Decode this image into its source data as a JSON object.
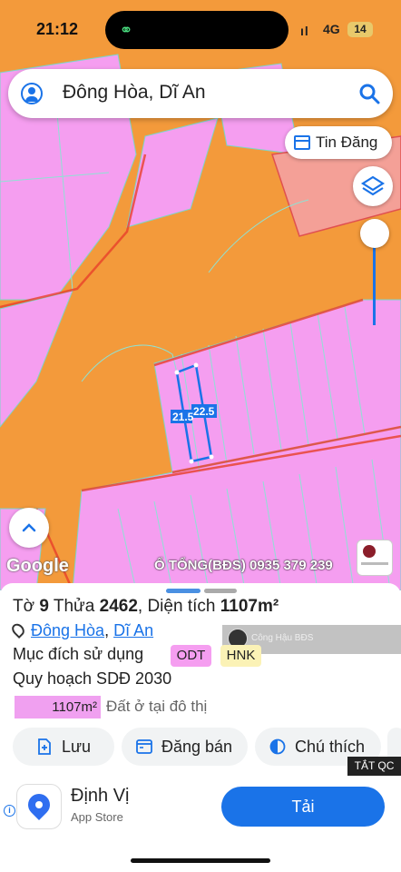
{
  "status_bar": {
    "time": "21:12",
    "network": "4G",
    "battery": "14"
  },
  "search": {
    "query": "Đông Hòa, Dĩ An"
  },
  "map": {
    "tin_dang_label": "Tin Đăng",
    "parcel_dims": [
      "21.5",
      "22.5"
    ],
    "google_logo": "Google",
    "watermark": "Ổ TỔNG(BĐS) 0935 379 239",
    "colors": {
      "road": "#f39a3b",
      "residential": "#f59ef0",
      "commercial": "#f4a097"
    }
  },
  "info": {
    "title_prefix": "Tờ",
    "sheet_no": "9",
    "plot_label": "Thửa",
    "plot_no": "2462",
    "area_label": ", Diện tích",
    "area_value": "1107m²",
    "ward": "Đông Hòa",
    "district": "Dĩ An",
    "purpose_label": "Mục đích sử dụng",
    "purpose_tags": [
      "ODT",
      "HNK"
    ],
    "plan_label": "Quy hoạch SDĐ 2030",
    "plan_area": "1107m²",
    "plan_desc": "Đất ở tại đô thị",
    "ad_overlay_name": "Công Hậu BĐS"
  },
  "actions": {
    "save": "Lưu",
    "post": "Đăng bán",
    "legend": "Chú thích"
  },
  "ad": {
    "hide_label": "TẮT QC",
    "app_name": "Định Vị",
    "store": "App Store",
    "cta": "Tải"
  }
}
